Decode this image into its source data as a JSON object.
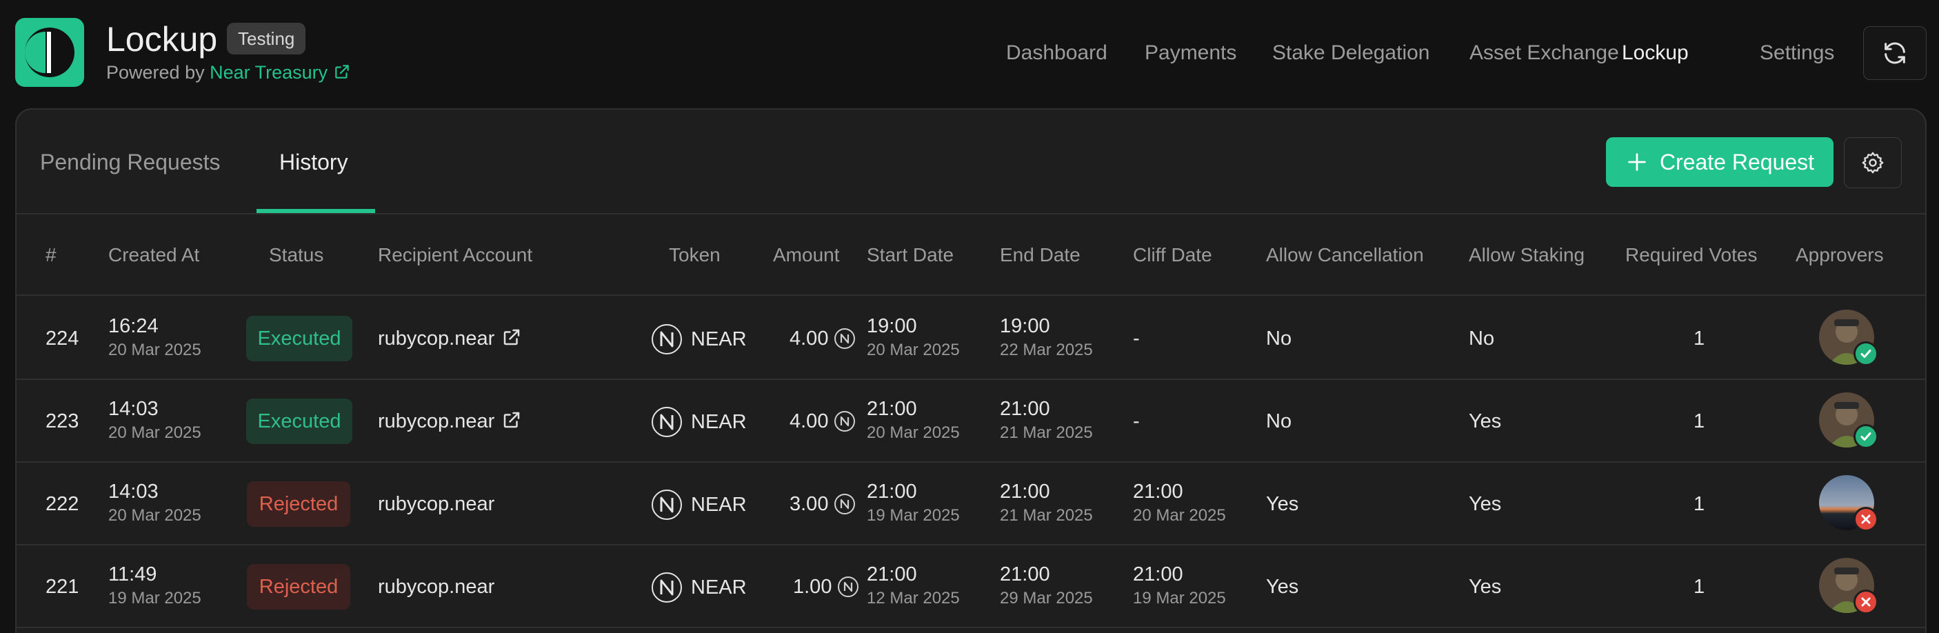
{
  "app": {
    "title": "Lockup",
    "badge": "Testing",
    "powered_prefix": "Powered by ",
    "powered_link": "Near Treasury"
  },
  "nav": {
    "items": [
      "Dashboard",
      "Payments",
      "Stake Delegation",
      "Asset Exchange",
      "Lockup",
      "Settings"
    ],
    "active": "Lockup"
  },
  "tabs": {
    "pending": "Pending Requests",
    "history": "History",
    "active": "History"
  },
  "actions": {
    "create_label": "Create Request"
  },
  "table": {
    "headers": {
      "id": "#",
      "created": "Created At",
      "status": "Status",
      "recipient": "Recipient Account",
      "token": "Token",
      "amount": "Amount",
      "start": "Start Date",
      "end": "End Date",
      "cliff": "Cliff Date",
      "cancel": "Allow Cancellation",
      "staking": "Allow Staking",
      "votes": "Required Votes",
      "approvers": "Approvers"
    },
    "rows": [
      {
        "id": "224",
        "created_time": "16:24",
        "created_date": "20 Mar 2025",
        "status": "Executed",
        "recipient": "rubycop.near",
        "token": "NEAR",
        "amount": "4.00",
        "start_time": "19:00",
        "start_date": "20 Mar 2025",
        "end_time": "19:00",
        "end_date": "22 Mar 2025",
        "cliff": "-",
        "cliff_time": "",
        "cliff_date": "",
        "cancel": "No",
        "staking": "No",
        "votes": "1"
      },
      {
        "id": "223",
        "created_time": "14:03",
        "created_date": "20 Mar 2025",
        "status": "Executed",
        "recipient": "rubycop.near",
        "token": "NEAR",
        "amount": "4.00",
        "start_time": "21:00",
        "start_date": "20 Mar 2025",
        "end_time": "21:00",
        "end_date": "21 Mar 2025",
        "cliff": "-",
        "cliff_time": "",
        "cliff_date": "",
        "cancel": "No",
        "staking": "Yes",
        "votes": "1"
      },
      {
        "id": "222",
        "created_time": "14:03",
        "created_date": "20 Mar 2025",
        "status": "Rejected",
        "recipient": "rubycop.near",
        "token": "NEAR",
        "amount": "3.00",
        "start_time": "21:00",
        "start_date": "19 Mar 2025",
        "end_time": "21:00",
        "end_date": "21 Mar 2025",
        "cliff": "",
        "cliff_time": "21:00",
        "cliff_date": "20 Mar 2025",
        "cancel": "Yes",
        "staking": "Yes",
        "votes": "1"
      },
      {
        "id": "221",
        "created_time": "11:49",
        "created_date": "19 Mar 2025",
        "status": "Rejected",
        "recipient": "rubycop.near",
        "token": "NEAR",
        "amount": "1.00",
        "start_time": "21:00",
        "start_date": "12 Mar 2025",
        "end_time": "21:00",
        "end_date": "29 Mar 2025",
        "cliff": "",
        "cliff_time": "21:00",
        "cliff_date": "19 Mar 2025",
        "cancel": "Yes",
        "staking": "Yes",
        "votes": "1"
      }
    ]
  },
  "colors": {
    "accent": "#23c38e",
    "executed_text": "#2fc08a",
    "rejected_text": "#e0604f",
    "background": "#121212",
    "panel": "#1e1e1e"
  },
  "icons": [
    "treasury-logo-icon",
    "external-link-icon",
    "refresh-icon",
    "plus-icon",
    "gear-icon",
    "near-token-icon",
    "approved-check-icon",
    "rejected-x-icon"
  ]
}
